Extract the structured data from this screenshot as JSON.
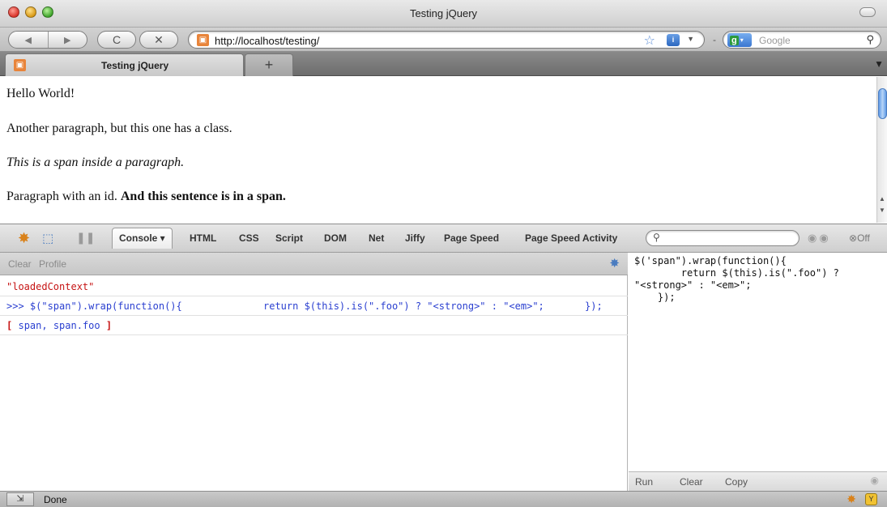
{
  "window": {
    "title": "Testing jQuery"
  },
  "toolbar": {
    "back_icon": "back-arrow-icon",
    "forward_icon": "forward-arrow-icon",
    "reload_glyph": "C",
    "stop_glyph": "✕",
    "url": "http://localhost/testing/",
    "search_placeholder": "Google",
    "search_engine_icon": "google-icon"
  },
  "tabs": [
    {
      "label": "Testing jQuery",
      "active": true
    }
  ],
  "newtab_label": "+",
  "page": {
    "paragraph_1": "Hello World!",
    "paragraph_2": "Another paragraph, but this one has a class.",
    "paragraph_3": "This is a span inside a paragraph.",
    "paragraph_4_plain": "Paragraph with an id.",
    "paragraph_4_bold": "And this sentence is in a span."
  },
  "firebug": {
    "tabs": [
      "Console",
      "HTML",
      "CSS",
      "Script",
      "DOM",
      "Net",
      "Jiffy",
      "Page Speed",
      "Page Speed Activity"
    ],
    "active_tab": "Console",
    "off_label": "Off",
    "console_actions": {
      "clear": "Clear",
      "profile": "Profile"
    },
    "log": {
      "context": "\"loadedContext\"",
      "command_part1": ">>> $(\"span\").wrap(function(){",
      "command_part2": "return $(this).is(\".foo\") ? \"<strong>\" : \"<em>\";",
      "command_part3": "});",
      "result_open": "[",
      "result_items": "span, span.foo",
      "result_close": "]"
    },
    "editor": {
      "code": "$('span\").wrap(function(){\n        return $(this).is(\".foo\") ?\n\"<strong>\" : \"<em>\";\n    });",
      "run": "Run",
      "clear": "Clear",
      "copy": "Copy"
    }
  },
  "statusbar": {
    "text": "Done"
  },
  "colors": {
    "console_error_red": "#c61414",
    "console_blue": "#2a3fd0",
    "scroll_thumb_blue": "#5f9ae6"
  }
}
